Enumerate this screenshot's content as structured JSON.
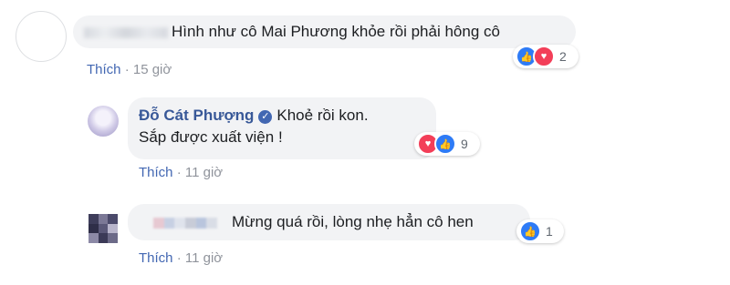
{
  "comments": [
    {
      "text": "Hình như cô Mai Phương khỏe rồi phải hông cô",
      "actions": {
        "like_label": "Thích",
        "separator": "·",
        "time": "15 giờ"
      },
      "reactions": {
        "icons": [
          "like-icon",
          "love-icon"
        ],
        "count": "2"
      }
    },
    {
      "author": "Đỗ Cát Phượng",
      "verified_badge": "✓",
      "text_line1": "Khoẻ rồi kon.",
      "text_line2": "Sắp được xuất viện !",
      "actions": {
        "like_label": "Thích",
        "separator": "·",
        "time": "11 giờ"
      },
      "reactions": {
        "icons": [
          "love-icon",
          "like-icon"
        ],
        "count": "9"
      }
    },
    {
      "text": "Mừng quá rồi, lòng nhẹ hẳn cô hen",
      "actions": {
        "like_label": "Thích",
        "separator": "·",
        "time": "11 giờ"
      },
      "reactions": {
        "icons": [
          "like-icon"
        ],
        "count": "1"
      }
    }
  ],
  "icon_glyphs": {
    "like": "👍",
    "love": "♥"
  },
  "colors": {
    "link_blue": "#385898",
    "bubble_bg": "#f2f3f5",
    "like_blue": "#2e7bf6",
    "love_red": "#f33e58",
    "meta_gray": "#90949c"
  }
}
